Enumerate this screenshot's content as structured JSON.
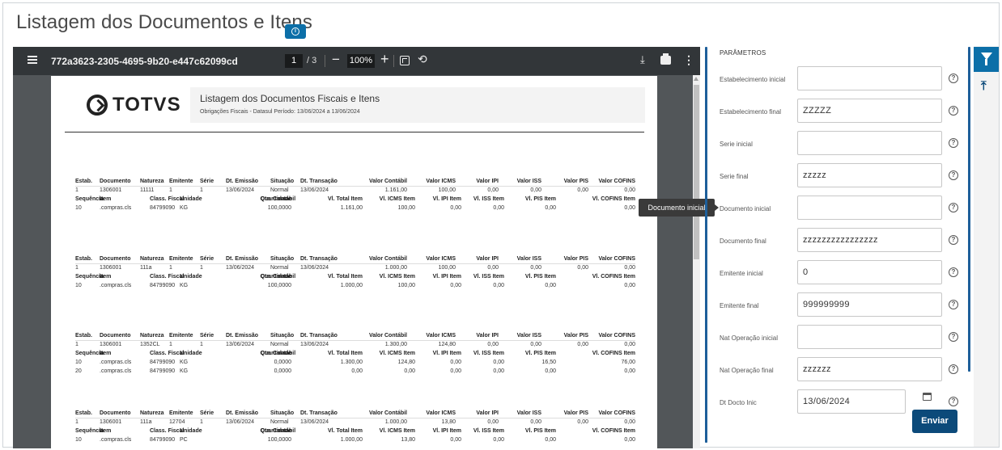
{
  "page": {
    "title": "Listagem dos Documentos e Itens"
  },
  "viewer": {
    "doc_name": "772a3623-2305-4695-9b20-e447c62099cd",
    "page_current": "1",
    "page_total": "/  3",
    "zoom": "100%"
  },
  "report": {
    "logo_text": "TOTVS",
    "title": "Listagem dos Documentos Fiscais e Itens",
    "subtitle": "Obrigações Fiscais - Datasul    Período:  13/06/2024  a  13/06/2024",
    "header1": [
      "Estab.",
      "Documento",
      "Natureza",
      "Emitente",
      "Série",
      "Dt. Emissão",
      "Situação",
      "Dt. Transação",
      "Valor Contábil",
      "Valor ICMS",
      "Valor IPI",
      "Valor ISS",
      "Valor PIS",
      "Valor COFINS"
    ],
    "header2": [
      "Sequência",
      "Item",
      "Class. Fiscal",
      "Unidade",
      "Quantidade",
      "Cta. Contábil",
      "Vl. Total Item",
      "Vl. ICMS Item",
      "Vl. IPI Item",
      "Vl. ISS Item",
      "Vl. PIS Item",
      "Vl. COFINS Item"
    ],
    "records": [
      {
        "doc": [
          "1",
          "1306001",
          "11111",
          "1",
          "1",
          "13/06/2024",
          "Normal",
          "13/06/2024",
          "1.161,00",
          "100,00",
          "0,00",
          "0,00",
          "0,00",
          "0,00"
        ],
        "items": [
          [
            "10",
            ".compras.cls",
            "84799090",
            "KG",
            "100,0000",
            "",
            "1.161,00",
            "100,00",
            "0,00",
            "0,00",
            "0,00",
            "0,00"
          ]
        ]
      },
      {
        "doc": [
          "1",
          "1306001",
          "111a",
          "1",
          "1",
          "13/06/2024",
          "Normal",
          "13/06/2024",
          "1.000,00",
          "100,00",
          "0,00",
          "0,00",
          "0,00",
          "0,00"
        ],
        "items": [
          [
            "10",
            ".compras.cls",
            "84799090",
            "KG",
            "100,0000",
            "",
            "1.000,00",
            "100,00",
            "0,00",
            "0,00",
            "0,00",
            "0,00"
          ]
        ]
      },
      {
        "doc": [
          "1",
          "1306001",
          "1352CL",
          "1",
          "1",
          "13/06/2024",
          "Normal",
          "13/06/2024",
          "1.300,00",
          "124,80",
          "0,00",
          "0,00",
          "0,00",
          "0,00"
        ],
        "items": [
          [
            "10",
            ".compras.cls",
            "84799090",
            "KG",
            "0,0000",
            "",
            "1.300,00",
            "124,80",
            "0,00",
            "0,00",
            "16,50",
            "76,00"
          ],
          [
            "20",
            ".compras.cls",
            "84799090",
            "KG",
            "0,0000",
            "",
            "0,00",
            "0,00",
            "0,00",
            "0,00",
            "0,00",
            "0,00"
          ]
        ]
      },
      {
        "doc": [
          "1",
          "1306001",
          "111a",
          "12704",
          "1",
          "13/06/2024",
          "Normal",
          "13/06/2024",
          "1.000,00",
          "13,80",
          "0,00",
          "0,00",
          "0,00",
          "0,00"
        ],
        "items": [
          [
            "10",
            ".compras.cls",
            "84799090",
            "PC",
            "100,0000",
            "",
            "1.000,00",
            "13,80",
            "0,00",
            "0,00",
            "0,00",
            "0,00"
          ]
        ]
      }
    ]
  },
  "params": {
    "title": "PARÂMETROS",
    "fields": [
      {
        "label": "Estabelecimento inicial",
        "value": ""
      },
      {
        "label": "Estabelecimento final",
        "value": "ZZZZZ"
      },
      {
        "label": "Serie inicial",
        "value": ""
      },
      {
        "label": "Serie final",
        "value": "zzzzz"
      },
      {
        "label": "Documento inicial",
        "value": ""
      },
      {
        "label": "Documento final",
        "value": "zzzzzzzzzzzzzzzz"
      },
      {
        "label": "Emitente inicial",
        "value": "0"
      },
      {
        "label": "Emitente final",
        "value": "999999999"
      },
      {
        "label": "Nat Operação inicial",
        "value": ""
      },
      {
        "label": "Nat Operação final",
        "value": "zzzzzz"
      },
      {
        "label": "Dt Docto Inic",
        "value": "13/06/2024"
      }
    ],
    "tooltip": "Documento inicial",
    "submit_label": "Enviar"
  },
  "colors": {
    "primary": "#0c6fa8",
    "dark_primary": "#0c4a7a",
    "viewer_bg": "#525659",
    "toolbar_bg": "#323639"
  }
}
